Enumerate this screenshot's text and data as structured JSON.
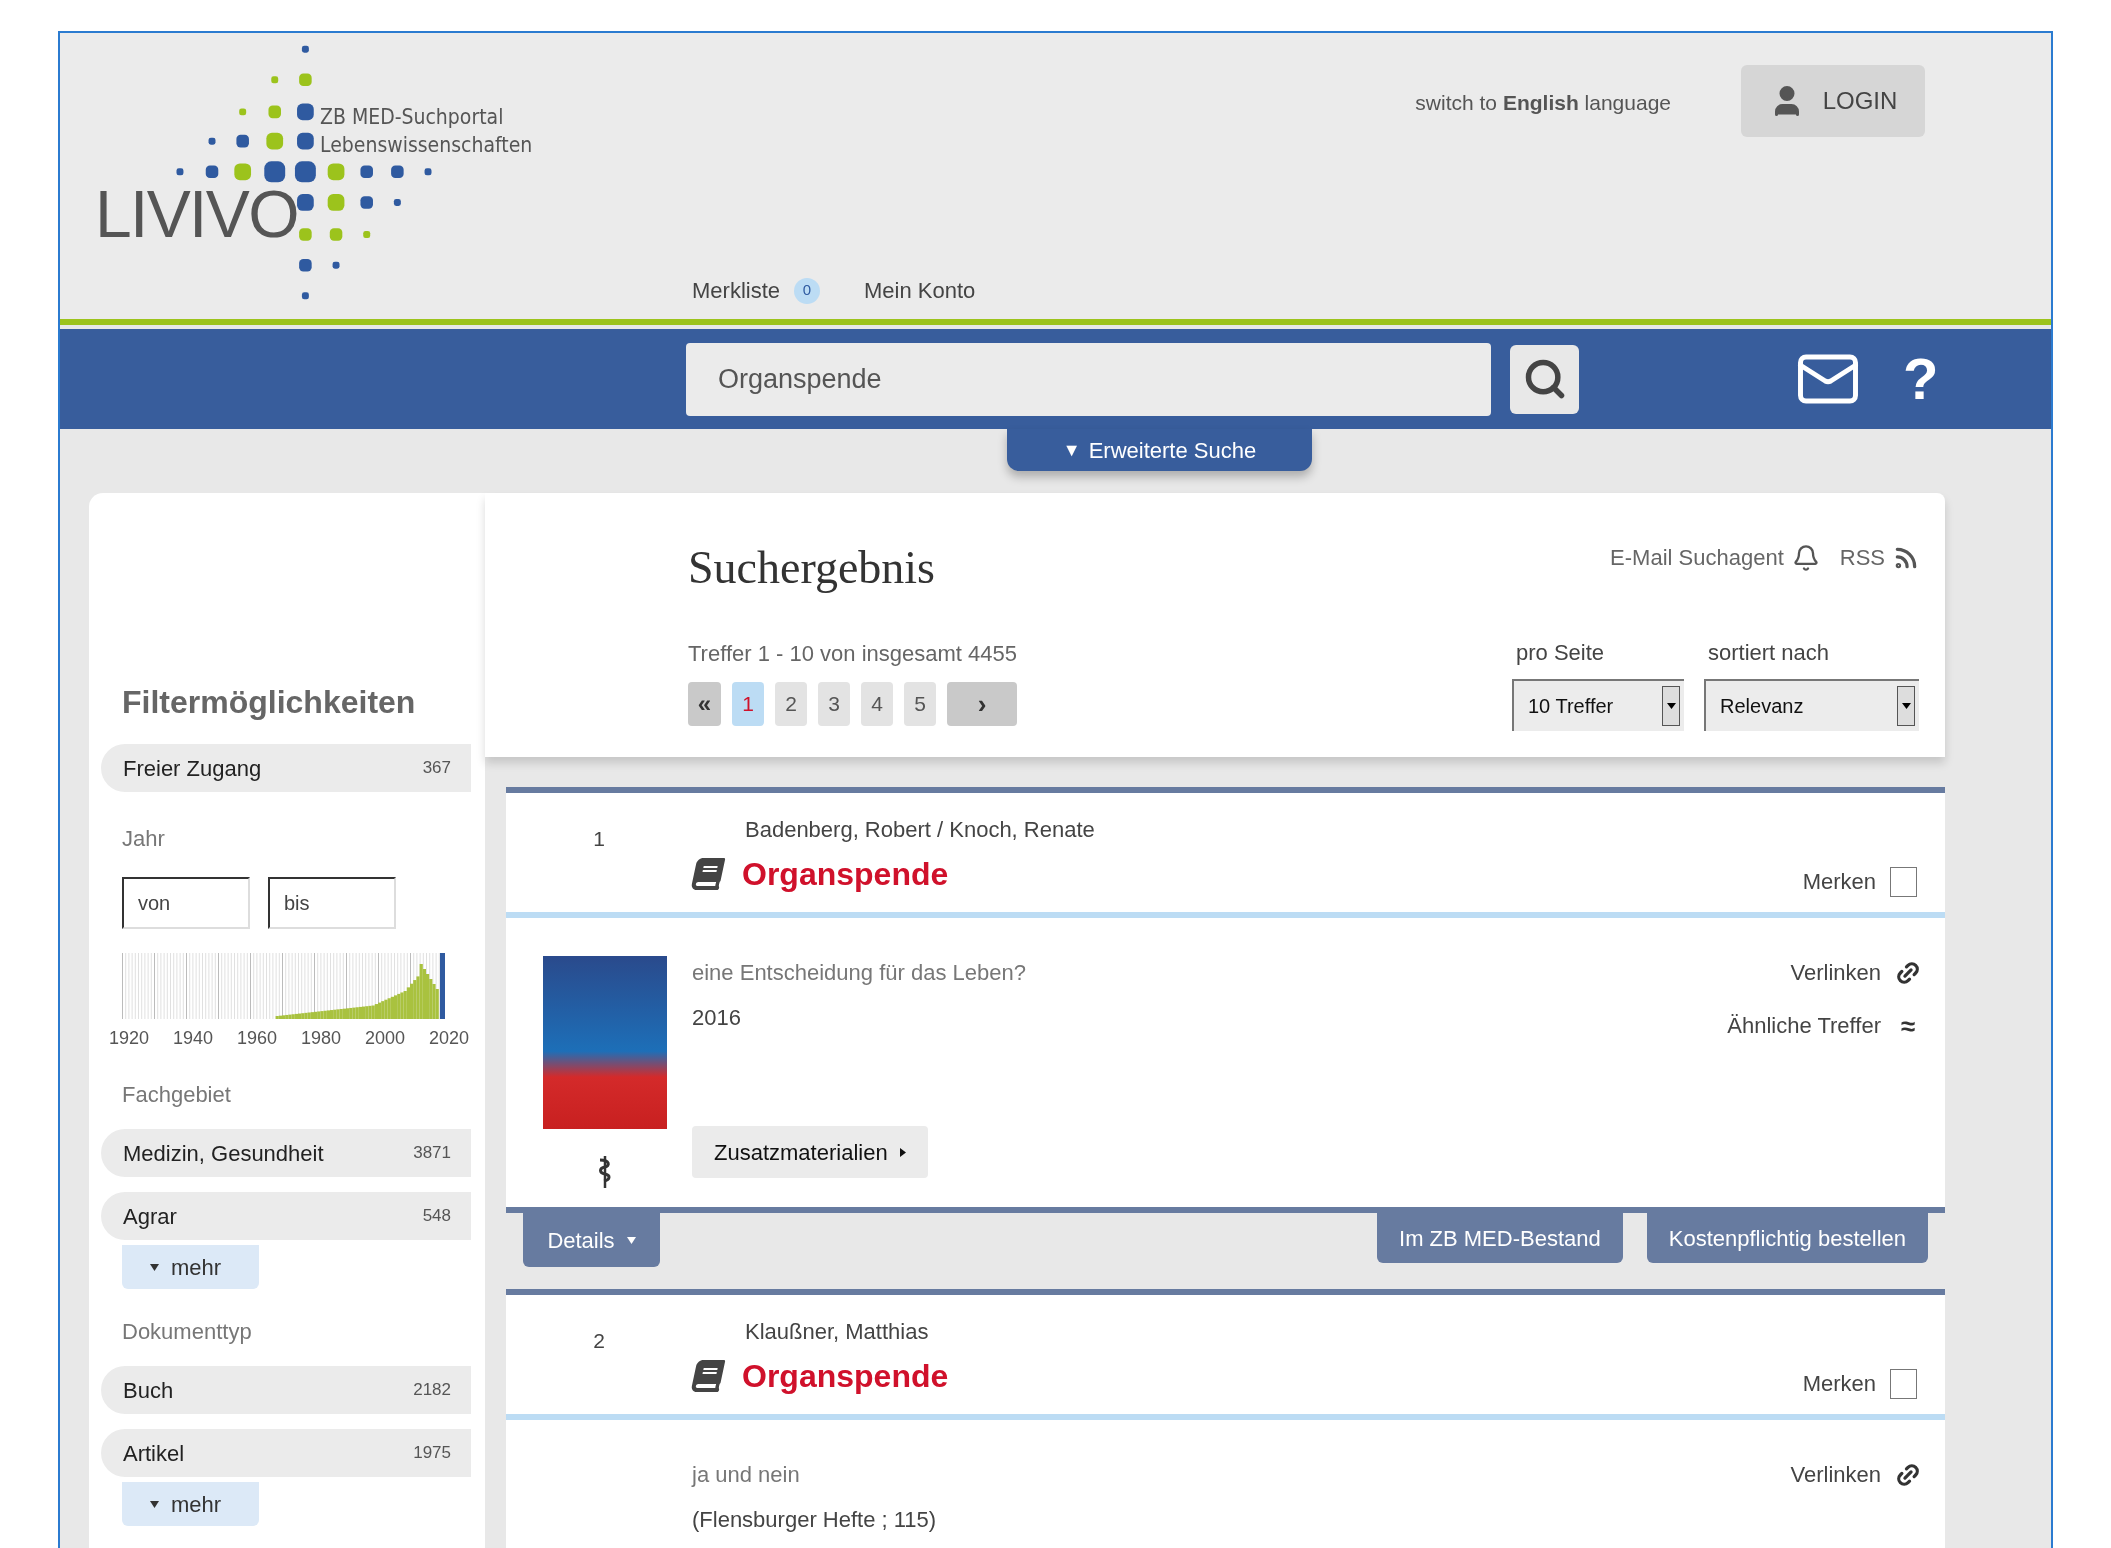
{
  "header": {
    "logo": {
      "wordmark": "LIVIVO",
      "subtitle_lines": [
        "ZB MED-Suchportal",
        "Lebenswissenschaften"
      ]
    },
    "language_switch": "switch to **English** language",
    "login": "LOGIN",
    "nav": [
      {
        "label": "Merkliste",
        "badge": "0"
      },
      {
        "label": "Mein Konto"
      }
    ]
  },
  "search": {
    "value": "Organspende",
    "help": "?"
  },
  "advanced_search": {
    "icon": "▼",
    "label": "Erweiterte Suche"
  },
  "sidebar": {
    "title": "Filtermöglichkeiten",
    "sections": [
      {
        "kind": "facets",
        "items": [
          {
            "label": "Freier Zugang",
            "count": "367"
          }
        ]
      },
      {
        "kind": "year",
        "heading": "Jahr",
        "from_placeholder": "von",
        "to_placeholder": "bis",
        "axis_labels": [
          "1920",
          "1940",
          "1960",
          "1980",
          "2000",
          "2020"
        ]
      },
      {
        "kind": "facets",
        "heading": "Fachgebiet",
        "items": [
          {
            "label": "Medizin, Gesundheit",
            "count": "3871"
          },
          {
            "label": "Agrar",
            "count": "548"
          }
        ],
        "more": "mehr"
      },
      {
        "kind": "facets",
        "heading": "Dokumenttyp",
        "items": [
          {
            "label": "Buch",
            "count": "2182"
          },
          {
            "label": "Artikel",
            "count": "1975"
          }
        ],
        "more": "mehr"
      }
    ]
  },
  "results_header": {
    "title": "Suchergebnis",
    "email_agent": "E-Mail Suchagent",
    "rss": "RSS",
    "hits": "Treffer 1 - 10 von insgesamt 4455",
    "pagination": {
      "first": "«",
      "next": "›",
      "pages": [
        {
          "label": "1",
          "selected": true
        },
        {
          "label": "2",
          "selected": false
        },
        {
          "label": "3",
          "selected": false
        },
        {
          "label": "4",
          "selected": false
        },
        {
          "label": "5",
          "selected": false
        }
      ]
    },
    "per_page": {
      "label": "pro Seite",
      "value": "10 Treffer"
    },
    "sort": {
      "label": "sortiert nach",
      "value": "Relevanz"
    }
  },
  "results": [
    {
      "number": "1",
      "authors": "Badenberg, Robert / Knoch, Renate",
      "title": "Organspende",
      "bookmark": {
        "label": "Merken",
        "checked": false
      },
      "subtitle": "eine Entscheidung für das Leben?",
      "lines": [
        "2016"
      ],
      "cover": true,
      "medical": true,
      "actions": [
        {
          "kind": "link",
          "label": "Verlinken"
        },
        {
          "kind": "similar",
          "label": "Ähnliche Treffer",
          "icon": "≈"
        }
      ],
      "extra_button": "Zusatzmaterialien",
      "details": "Details",
      "buttons": [
        "Im ZB MED-Bestand",
        "Kostenpflichtig bestellen"
      ]
    },
    {
      "number": "2",
      "authors": "Klaußner, Matthias",
      "title": "Organspende",
      "bookmark": {
        "label": "Merken",
        "checked": false
      },
      "subtitle": "ja und nein",
      "lines": [
        "(Flensburger Hefte ; 115)"
      ],
      "cover": false,
      "medical": false,
      "actions": [
        {
          "kind": "link",
          "label": "Verlinken"
        }
      ]
    }
  ]
}
